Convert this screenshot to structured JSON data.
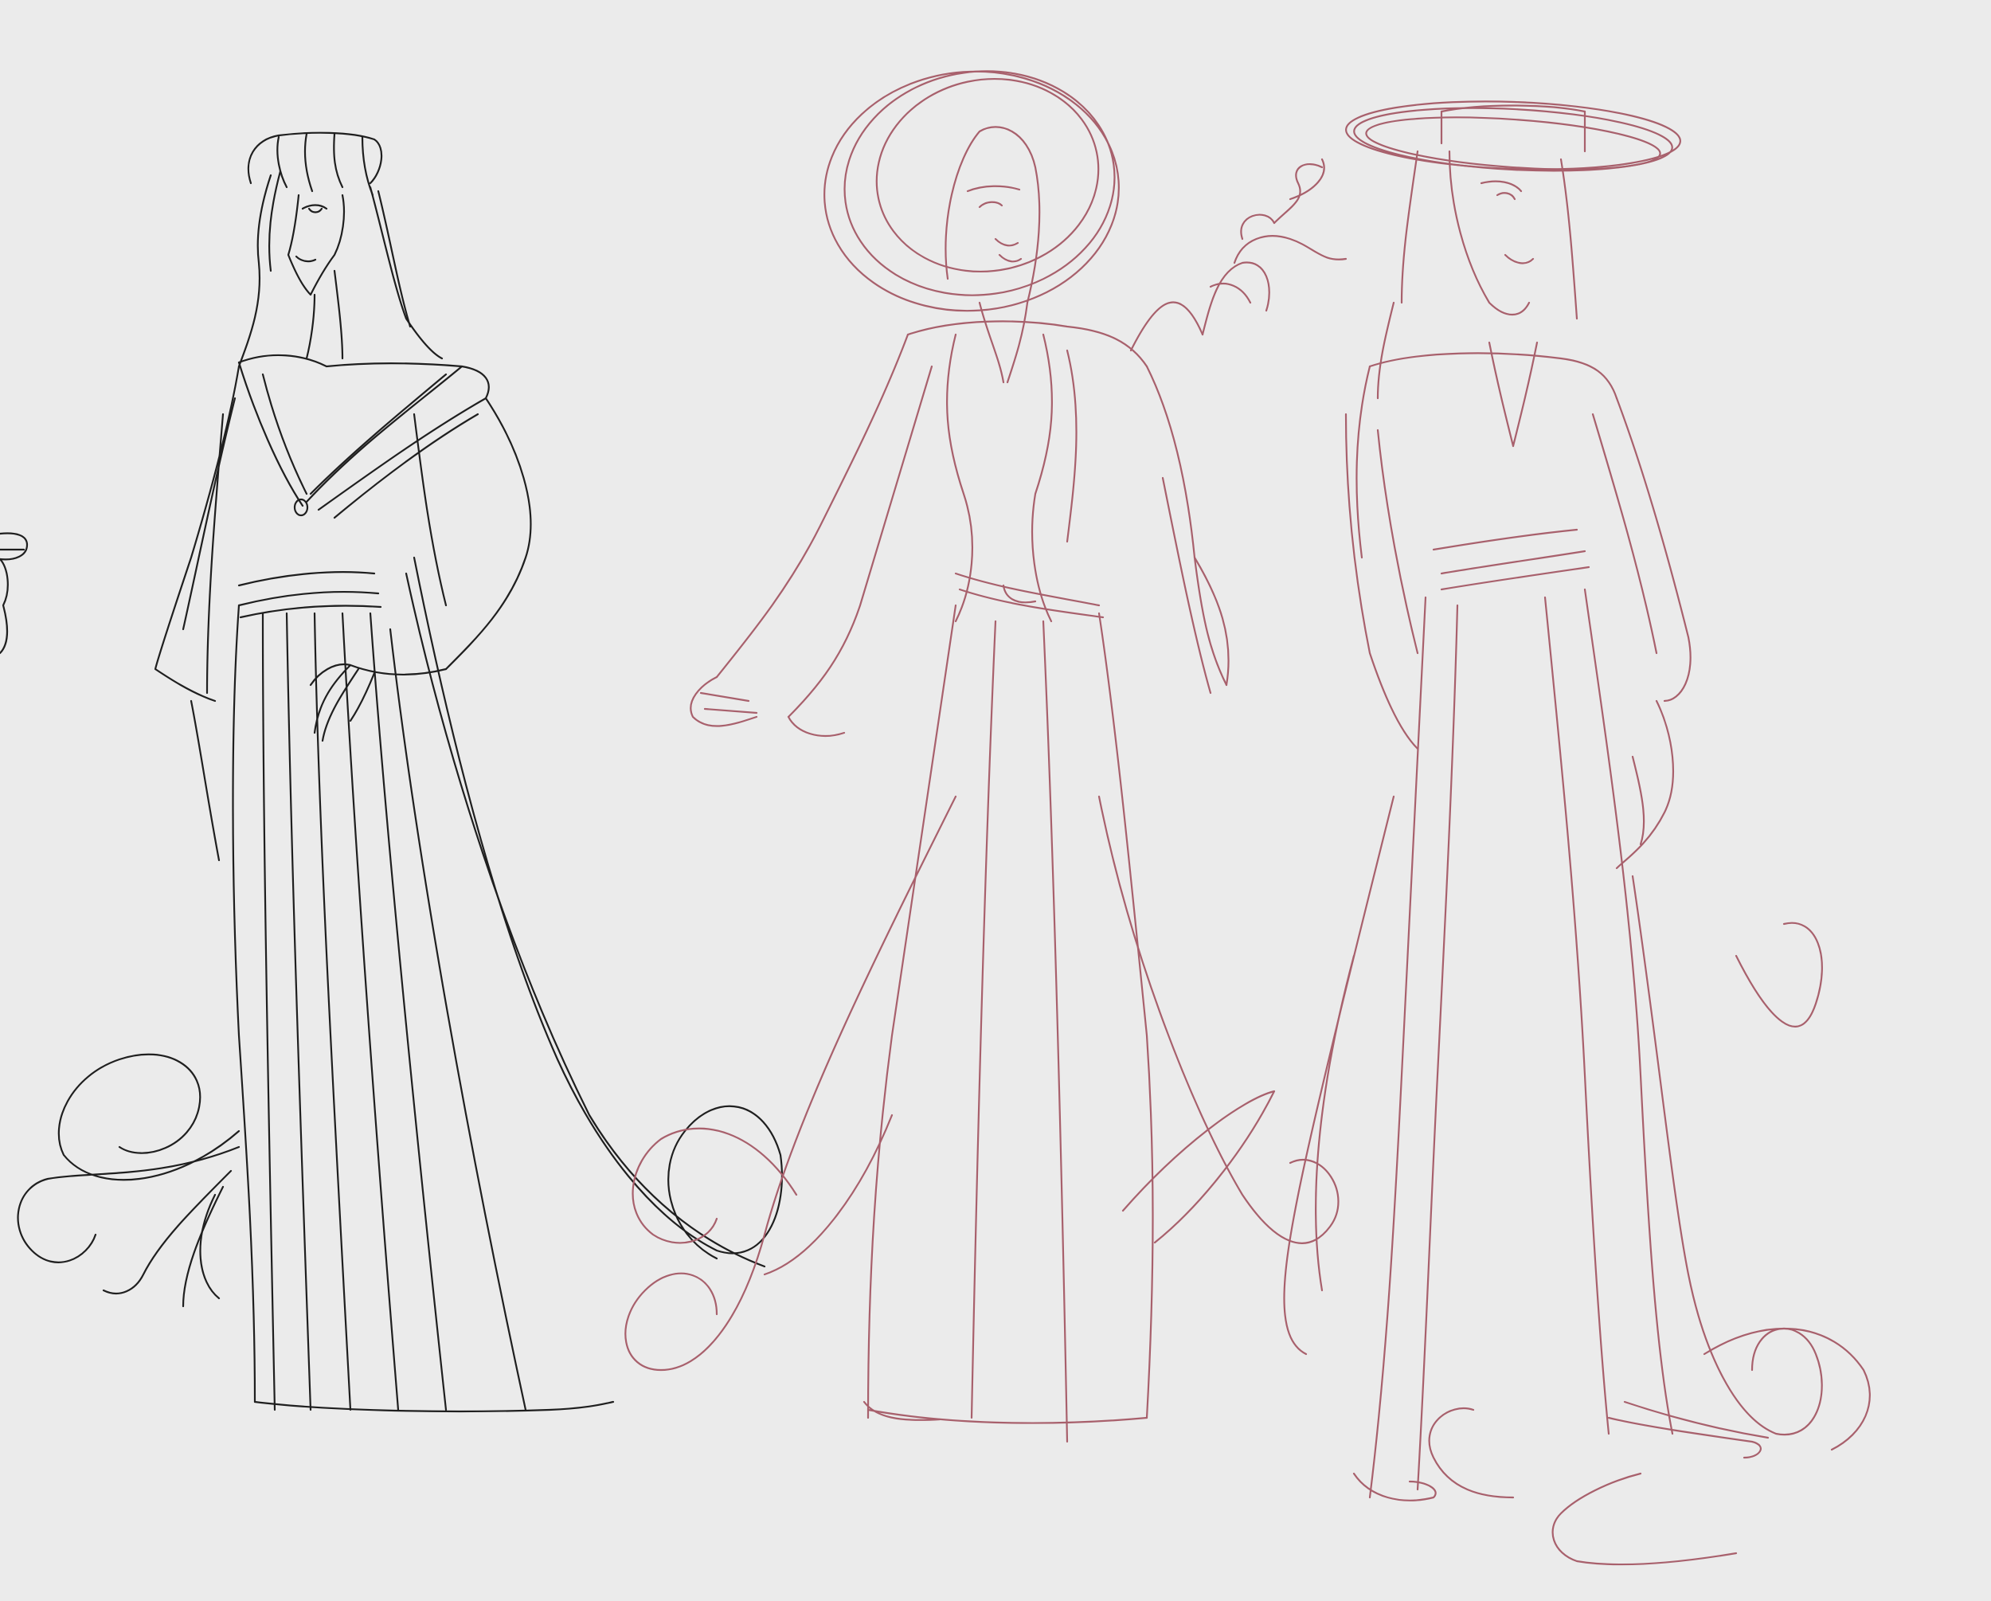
{
  "canvas": {
    "background": "#ebebeb"
  },
  "figures": [
    {
      "name": "figure-1-lineart",
      "ink": "black",
      "color": "#1f1f1f",
      "stroke_width": 2.2
    },
    {
      "name": "figure-2-sketch",
      "ink": "rose",
      "color": "#a8606c",
      "stroke_width": 2.2
    },
    {
      "name": "figure-3-sketch",
      "ink": "rose",
      "color": "#a8606c",
      "stroke_width": 2.2
    }
  ],
  "edge_fragment": {
    "color": "#1f1f1f"
  }
}
